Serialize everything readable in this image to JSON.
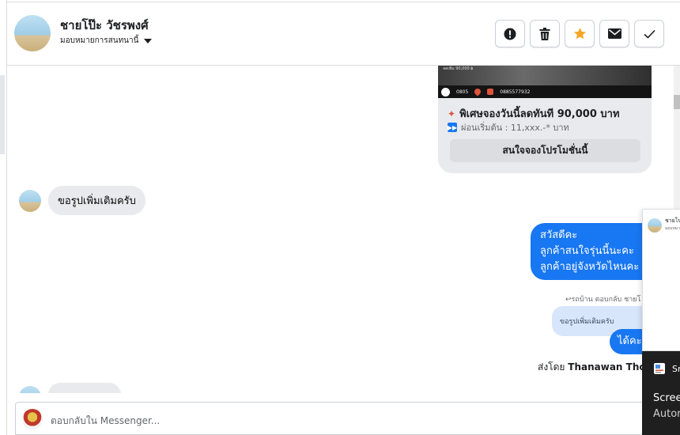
{
  "header": {
    "name": "ชายโป๊ะ วัชรพงศ์",
    "assign_label": "มอบหมายการสนทนานี้",
    "actions": [
      {
        "icon": "alert-icon",
        "label": "spam"
      },
      {
        "icon": "trash-icon",
        "label": "delete"
      },
      {
        "icon": "star-icon",
        "label": "star"
      },
      {
        "icon": "envelope-icon",
        "label": "mark unread"
      },
      {
        "icon": "check-icon",
        "label": "done"
      }
    ]
  },
  "promo": {
    "banner_phone": "0885577932",
    "banner_code": "0805",
    "title": "พิเศษจองวันนี้ลดทันที 90,000 บาท",
    "subtitle": "ผ่อนเริ่มต้น : 11,xxx.-* บาท",
    "button": "สนใจจองโปรโมชั่นนี้"
  },
  "messages": {
    "incoming_1": "ขอรูปเพิ่มเติมครับ",
    "outgoing_lines": [
      "สวัสดีคะ",
      "ลูกค้าสนใจรุ่นนี้นะคะ",
      "ลูกค้าอยู่จังหวัดไหนคะ"
    ],
    "reply_ref": "รถบ้าน ตอบกลับ ชายโ",
    "quoted": "ขอรูปเพิ่มเติมครับ",
    "outgoing_2": "ได้คะ",
    "sent_by_prefix": "ส่งโดย",
    "sent_by_name": "Thanawan Thon"
  },
  "composer": {
    "placeholder": "ตอบกลับใน Messenger..."
  },
  "float_panel": {
    "name": "ชายโป",
    "sub": "มอบหมา"
  },
  "toast": {
    "app": "Sn",
    "title": "Scree",
    "subtitle": "Autor"
  },
  "colors": {
    "accent": "#1877f2",
    "bubble_in": "#e9eaed",
    "star": "#f5a623"
  }
}
